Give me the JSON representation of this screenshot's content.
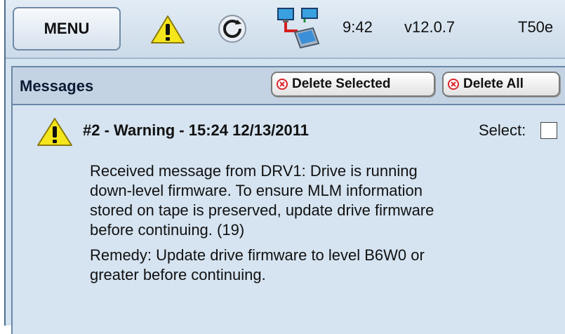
{
  "topbar": {
    "menu_label": "MENU",
    "icons": [
      "warning-icon",
      "refresh-icon",
      "network-computer-icon"
    ],
    "time": "9:42",
    "version": "v12.0.7",
    "device": "T50e"
  },
  "messages": {
    "title": "Messages",
    "delete_selected_label": "Delete Selected",
    "delete_all_label": "Delete All"
  },
  "message": {
    "header": "#2 - Warning - 15:24 12/13/2011",
    "select_label": "Select:",
    "selected": false,
    "body_lines": [
      "Received message from DRV1: Drive is running",
      "down-level firmware. To ensure MLM information",
      "stored on tape is preserved, update drive firmware",
      "before continuing. (19)"
    ],
    "remedy_lines": [
      "Remedy: Update drive firmware to level B6W0 or",
      "greater before continuing."
    ]
  },
  "colors": {
    "background": "#d4e3f0",
    "header": "#c3d3e3",
    "warning_yellow": "#f5e51c",
    "delete_red": "#d8262b"
  }
}
